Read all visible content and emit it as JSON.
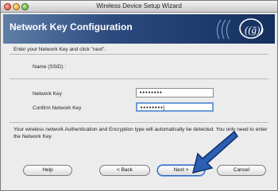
{
  "window": {
    "title": "Wireless Device Setup Wizard"
  },
  "banner": {
    "title": "Network Key Configuration",
    "logo_icon": "wifi-swirl-icon"
  },
  "form": {
    "instruction": "Enter your Network Key and click \"next\".",
    "ssid_label": "Name (SSID) :",
    "network_key_label": "Network Key",
    "network_key_value": "••••••••",
    "confirm_key_label": "Confirm Network Key",
    "confirm_key_value": "••••••••|"
  },
  "info_text": "Your wireless network Authentication and Encryption type will automatically be detected. You only need to enter the Network Key.",
  "buttons": {
    "help": "Help",
    "back": "< Back",
    "next": "Next >",
    "cancel": "Cancel"
  },
  "colors": {
    "banner_start": "#5f7fa8",
    "banner_end": "#15305e",
    "arrow": "#2a5fb3"
  }
}
